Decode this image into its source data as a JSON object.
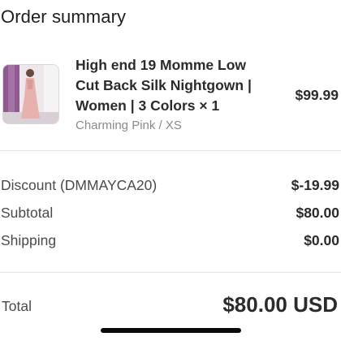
{
  "header": {
    "title": "Order summary"
  },
  "item": {
    "name": "High end 19 Momme Low Cut Back Silk Nightgown | Women | 3 Colors × 1",
    "price": "$99.99",
    "variant": "Charming Pink / XS"
  },
  "summary": {
    "discount_label": "Discount (DMMAYCA20)",
    "discount_value": "$-19.99",
    "subtotal_label": "Subtotal",
    "subtotal_value": "$80.00",
    "shipping_label": "Shipping",
    "shipping_value": "$0.00"
  },
  "total": {
    "label": "Total",
    "value": "$80.00 USD"
  },
  "colors": {
    "text": "#2b2b2b",
    "muted": "#8a8a8a",
    "divider": "#e2e2e2"
  }
}
